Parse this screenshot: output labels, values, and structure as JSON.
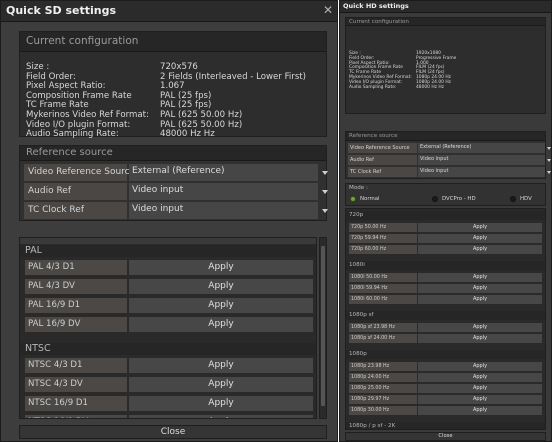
{
  "sd": {
    "title": "Quick SD settings",
    "close_glyph": "✕",
    "config": {
      "heading": "Current configuration",
      "rows": [
        {
          "key": "Size :",
          "value": "720x576"
        },
        {
          "key": "Field Order:",
          "value": "2 Fields (Interleaved - Lower First)"
        },
        {
          "key": "Pixel Aspect Ratio:",
          "value": "1.067"
        },
        {
          "key": "Composition Frame Rate",
          "value": "PAL (25 fps)"
        },
        {
          "key": "TC Frame Rate",
          "value": "PAL (25 fps)"
        },
        {
          "key": "Mykerinos Video Ref Format:",
          "value": "PAL  (625 50.00 Hz)"
        },
        {
          "key": "Video I/O plugin Format:",
          "value": "PAL  (625 50.00 Hz)"
        },
        {
          "key": "Audio Sampling Rate:",
          "value": "48000 Hz Hz"
        }
      ]
    },
    "reference": {
      "heading": "Reference source",
      "rows": [
        {
          "label": "Video Reference Source",
          "value": "External (Reference)"
        },
        {
          "label": "Audio Ref",
          "value": "Video input"
        },
        {
          "label": "TC Clock Ref",
          "value": "Video input"
        }
      ]
    },
    "apply_label": "Apply",
    "groups": [
      {
        "heading": "PAL",
        "items": [
          "PAL 4/3 D1",
          "PAL 4/3 DV",
          "PAL 16/9 D1",
          "PAL 16/9 DV"
        ]
      },
      {
        "heading": "NTSC",
        "items": [
          "NTSC 4/3 D1",
          "NTSC 4/3 DV",
          "NTSC 16/9 D1",
          "NTSC 16/9 DV"
        ]
      }
    ],
    "close_label": "Close"
  },
  "hd": {
    "title": "Quick HD settings",
    "config": {
      "heading": "Current configuration",
      "rows": [
        {
          "key": "Size :",
          "value": "1920x1080"
        },
        {
          "key": "Field Order:",
          "value": "Progressive Frame"
        },
        {
          "key": "Pixel Aspect Ratio:",
          "value": "1.000"
        },
        {
          "key": "Composition Frame Rate",
          "value": "FILM (24 fps)"
        },
        {
          "key": "TC Frame Rate",
          "value": "FILM (24 fps)"
        },
        {
          "key": "Mykerinos Video Ref Format:",
          "value": "1080p 24.00 Hz"
        },
        {
          "key": "Video I/O plugin Format:",
          "value": "1080p 24.00 Hz"
        },
        {
          "key": "Audio Sampling Rate:",
          "value": "48000 Hz Hz"
        }
      ]
    },
    "reference": {
      "heading": "Reference source",
      "rows": [
        {
          "label": "Video Reference Source",
          "value": "External (Reference)"
        },
        {
          "label": "Audio Ref",
          "value": "Video input"
        },
        {
          "label": "TC Clock Ref",
          "value": "Video input"
        }
      ]
    },
    "mode": {
      "label": "Mode :",
      "options": [
        {
          "label": "Normal",
          "selected": true
        },
        {
          "label": "DVCPro - HD",
          "selected": false
        },
        {
          "label": "HDV",
          "selected": false
        }
      ]
    },
    "apply_label": "Apply",
    "groups": [
      {
        "heading": "720p",
        "items": [
          "720p 50.00 Hz",
          "720p 59.94 Hz",
          "720p 60.00 Hz"
        ]
      },
      {
        "heading": "1080i",
        "items": [
          "1080i 50.00 Hz",
          "1080i 59.94 Hz",
          "1080i 60.00 Hz"
        ]
      },
      {
        "heading": "1080p sf",
        "items": [
          "1080p sf 23.98 Hz",
          "1080p sf 24.00 Hz"
        ]
      },
      {
        "heading": "1080p",
        "items": [
          "1080p 23.98 Hz",
          "1080p 24.00 Hz",
          "1080p 25.00 Hz",
          "1080p 29.97 Hz",
          "1080p 30.00 Hz"
        ]
      },
      {
        "heading": "1080p / p sf - 2K",
        "items": []
      }
    ],
    "close_label": "Close"
  },
  "colors": {
    "window_bg": "#3d3d3d",
    "panel_bg": "#2d2d2d",
    "label_bg": "#4b4845",
    "button_bg": "#474747",
    "mode_selected": "#6ca33a"
  }
}
